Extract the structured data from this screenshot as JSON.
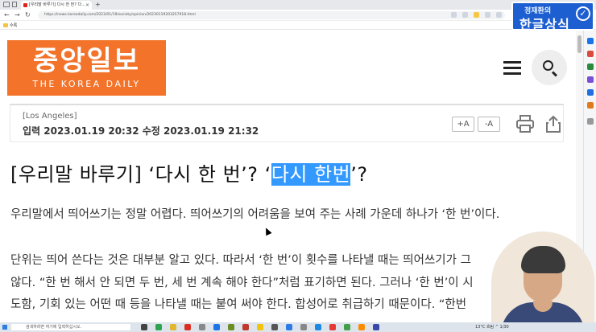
{
  "browser": {
    "tab_title": "[우리말 바루기] 다시 한 번? 다...",
    "tab_close": "×",
    "new_tab": "+",
    "back": "←",
    "forward": "→",
    "reload": "↻",
    "url": "https://news.koreadaily.com/2023/01/19/society/opinion/20230119203257918.html",
    "favorites_folder": "수록"
  },
  "header": {
    "logo_korean": "중앙일보",
    "logo_english": "THE KOREA DAILY"
  },
  "meta": {
    "location": "[Los Angeles]",
    "dates": "입력 2023.01.19 20:32 수정 2023.01.19 21:32",
    "font_increase": "+A",
    "font_decrease": "-A"
  },
  "article": {
    "headline_prefix": "[우리말 바루기] ‘다시 한 번’? ‘",
    "headline_highlight": "다시 한번",
    "headline_suffix": "’?",
    "para1": "우리말에서 띄어쓰기는 정말 어렵다. 띄어쓰기의 어려움을 보여 주는 사례 가운데 하나가 ‘한 번’이다.",
    "para2_line1": "단위는 띄어 쓴다는 것은 대부분 알고 있다. 따라서 ‘한 번’이 횟수를 나타낼 때는 띄어쓰기가 그",
    "para2_line2": "않다. “한 번 해서 안 되면 두 번, 세 번 계속 해야 한다”처럼 표기하면 된다. 그러나 ‘한 번’이 시",
    "para2_line3": "도함, 기회 있는 어떤 때 등을 나타낼 때는 붙여 써야 한다. 합성어로 취급하기 때문이다. “한번"
  },
  "overlay": {
    "badge_top": "정재환의",
    "badge_main": "한글상식",
    "badge_check": "✓"
  },
  "taskbar": {
    "search_placeholder": "검색하려면 여기에 입력하십시오.",
    "weather": "13°C 흐림  ^ 1/30"
  },
  "colors": {
    "brand_orange": "#f27329",
    "selection_blue": "#3399ff",
    "badge_blue": "#1d5fd1"
  }
}
